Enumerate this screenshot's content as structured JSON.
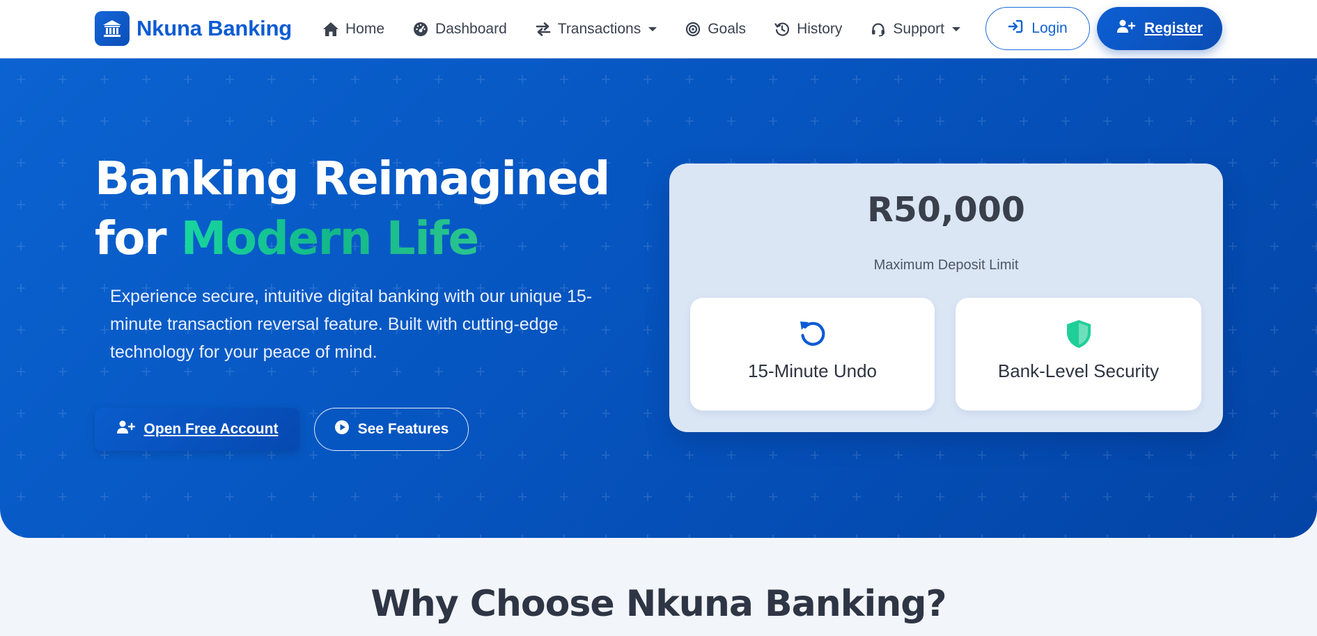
{
  "navbar": {
    "brand_name": "Nkuna Banking",
    "links": [
      {
        "label": "Home",
        "icon": "home-icon"
      },
      {
        "label": "Dashboard",
        "icon": "dashboard-gauge-icon"
      },
      {
        "label": "Transactions",
        "icon": "exchange-arrows-icon",
        "dropdown": true
      },
      {
        "label": "Goals",
        "icon": "target-icon"
      },
      {
        "label": "History",
        "icon": "history-clock-icon"
      },
      {
        "label": "Support",
        "icon": "headset-icon",
        "dropdown": true
      }
    ],
    "login_label": "Login",
    "register_label": "Register"
  },
  "hero": {
    "title_line1": "Banking Reimagined",
    "title_line2_plain": "for ",
    "title_line2_accent": "Modern Life",
    "description": "Experience secure, intuitive digital banking with our unique 15-minute transaction reversal feature. Built with cutting-edge technology for your peace of mind.",
    "primary_button": "Open Free Account",
    "secondary_button": "See Features"
  },
  "stat_card": {
    "amount": "R50,000",
    "label": "Maximum Deposit Limit",
    "features": [
      {
        "title": "15-Minute Undo",
        "icon": "undo-icon"
      },
      {
        "title": "Bank-Level Security",
        "icon": "shield-icon"
      }
    ]
  },
  "section": {
    "title": "Why Choose Nkuna Banking?"
  },
  "colors": {
    "brand_blue": "#0b5bd3",
    "hero_start": "#0b63d1",
    "hero_end": "#0344a6",
    "accent_green": "#18d5a0",
    "security_green": "#1fcf97"
  }
}
